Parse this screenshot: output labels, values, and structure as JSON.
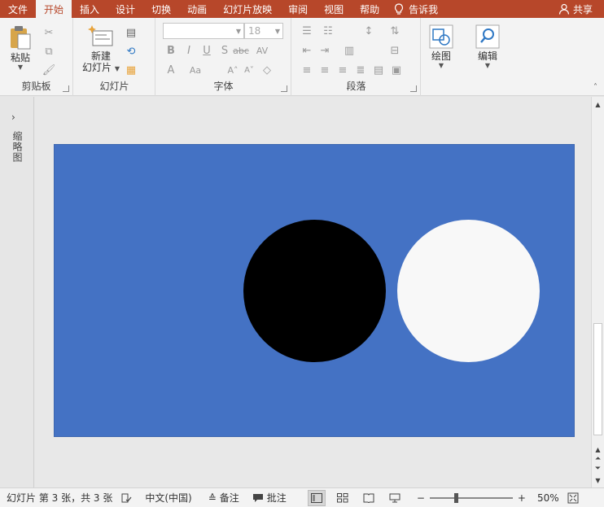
{
  "tabs": [
    {
      "label": "文件",
      "active": false
    },
    {
      "label": "开始",
      "active": true
    },
    {
      "label": "插入",
      "active": false
    },
    {
      "label": "设计",
      "active": false
    },
    {
      "label": "切换",
      "active": false
    },
    {
      "label": "动画",
      "active": false
    },
    {
      "label": "幻灯片放映",
      "active": false
    },
    {
      "label": "审阅",
      "active": false
    },
    {
      "label": "视图",
      "active": false
    },
    {
      "label": "帮助",
      "active": false
    }
  ],
  "tell_me": "告诉我",
  "share": "共享",
  "ribbon": {
    "clipboard": {
      "paste_label": "粘贴",
      "group_label": "剪贴板"
    },
    "slides": {
      "new_slide_label_1": "新建",
      "new_slide_label_2": "幻灯片",
      "group_label": "幻灯片"
    },
    "font": {
      "font_name": "",
      "font_size": "18",
      "group_label": "字体"
    },
    "paragraph": {
      "group_label": "段落"
    },
    "drawing": {
      "label": "绘图"
    },
    "editing": {
      "label": "编辑"
    }
  },
  "left_pane": {
    "label": "缩略图"
  },
  "slide": {
    "background_color": "#4472c4",
    "shapes": [
      {
        "type": "circle",
        "fill": "#000000"
      },
      {
        "type": "circle",
        "fill": "#f8f8f8"
      }
    ]
  },
  "status": {
    "slide_info": "幻灯片 第 3 张，共 3 张",
    "language": "中文(中国)",
    "notes": "备注",
    "comments": "批注",
    "zoom": "50%"
  },
  "colors": {
    "accent": "#b7472a",
    "ribbon_bg": "#f3f3f3"
  }
}
